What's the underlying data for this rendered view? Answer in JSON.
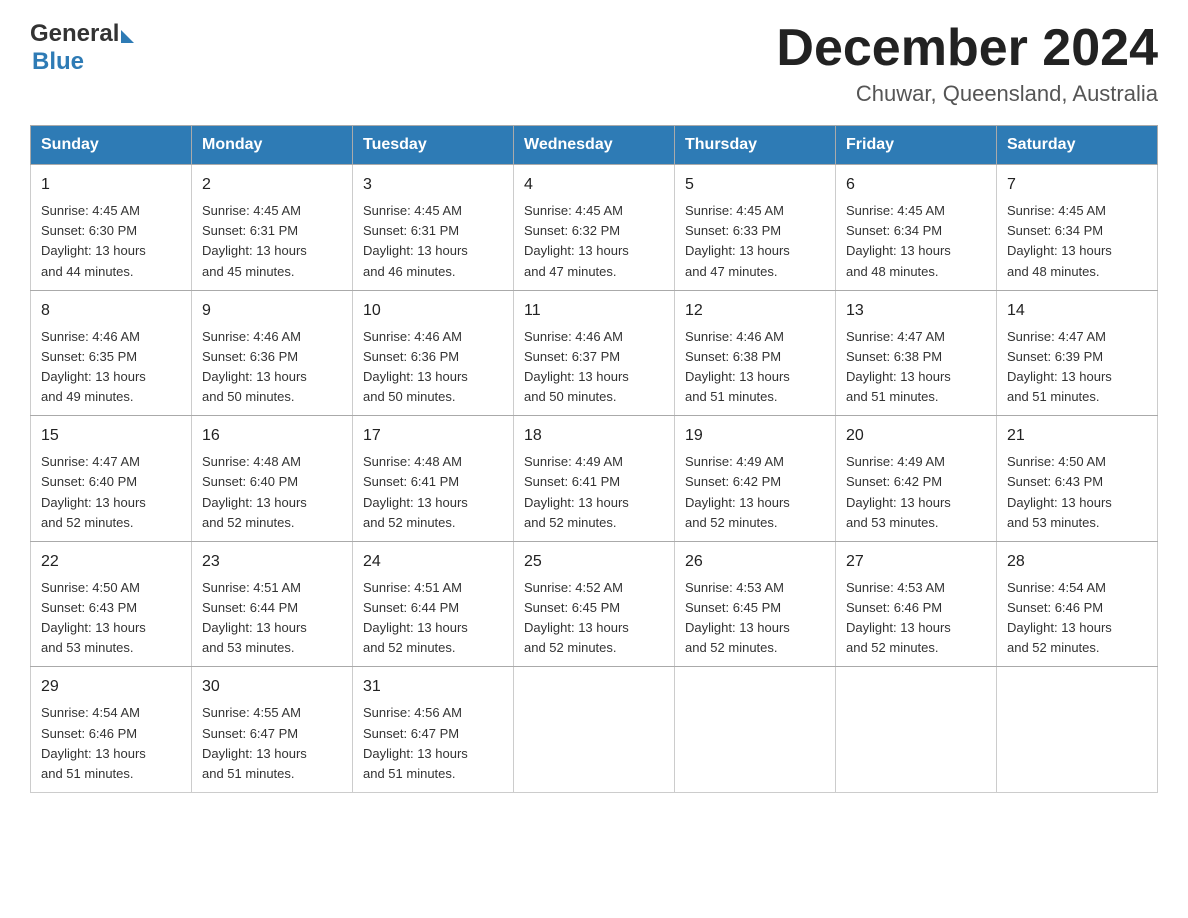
{
  "header": {
    "logo_general": "General",
    "logo_blue": "Blue",
    "title": "December 2024",
    "subtitle": "Chuwar, Queensland, Australia"
  },
  "days_of_week": [
    "Sunday",
    "Monday",
    "Tuesday",
    "Wednesday",
    "Thursday",
    "Friday",
    "Saturday"
  ],
  "weeks": [
    [
      {
        "day": "1",
        "sunrise": "4:45 AM",
        "sunset": "6:30 PM",
        "daylight": "13 hours and 44 minutes."
      },
      {
        "day": "2",
        "sunrise": "4:45 AM",
        "sunset": "6:31 PM",
        "daylight": "13 hours and 45 minutes."
      },
      {
        "day": "3",
        "sunrise": "4:45 AM",
        "sunset": "6:31 PM",
        "daylight": "13 hours and 46 minutes."
      },
      {
        "day": "4",
        "sunrise": "4:45 AM",
        "sunset": "6:32 PM",
        "daylight": "13 hours and 47 minutes."
      },
      {
        "day": "5",
        "sunrise": "4:45 AM",
        "sunset": "6:33 PM",
        "daylight": "13 hours and 47 minutes."
      },
      {
        "day": "6",
        "sunrise": "4:45 AM",
        "sunset": "6:34 PM",
        "daylight": "13 hours and 48 minutes."
      },
      {
        "day": "7",
        "sunrise": "4:45 AM",
        "sunset": "6:34 PM",
        "daylight": "13 hours and 48 minutes."
      }
    ],
    [
      {
        "day": "8",
        "sunrise": "4:46 AM",
        "sunset": "6:35 PM",
        "daylight": "13 hours and 49 minutes."
      },
      {
        "day": "9",
        "sunrise": "4:46 AM",
        "sunset": "6:36 PM",
        "daylight": "13 hours and 50 minutes."
      },
      {
        "day": "10",
        "sunrise": "4:46 AM",
        "sunset": "6:36 PM",
        "daylight": "13 hours and 50 minutes."
      },
      {
        "day": "11",
        "sunrise": "4:46 AM",
        "sunset": "6:37 PM",
        "daylight": "13 hours and 50 minutes."
      },
      {
        "day": "12",
        "sunrise": "4:46 AM",
        "sunset": "6:38 PM",
        "daylight": "13 hours and 51 minutes."
      },
      {
        "day": "13",
        "sunrise": "4:47 AM",
        "sunset": "6:38 PM",
        "daylight": "13 hours and 51 minutes."
      },
      {
        "day": "14",
        "sunrise": "4:47 AM",
        "sunset": "6:39 PM",
        "daylight": "13 hours and 51 minutes."
      }
    ],
    [
      {
        "day": "15",
        "sunrise": "4:47 AM",
        "sunset": "6:40 PM",
        "daylight": "13 hours and 52 minutes."
      },
      {
        "day": "16",
        "sunrise": "4:48 AM",
        "sunset": "6:40 PM",
        "daylight": "13 hours and 52 minutes."
      },
      {
        "day": "17",
        "sunrise": "4:48 AM",
        "sunset": "6:41 PM",
        "daylight": "13 hours and 52 minutes."
      },
      {
        "day": "18",
        "sunrise": "4:49 AM",
        "sunset": "6:41 PM",
        "daylight": "13 hours and 52 minutes."
      },
      {
        "day": "19",
        "sunrise": "4:49 AM",
        "sunset": "6:42 PM",
        "daylight": "13 hours and 52 minutes."
      },
      {
        "day": "20",
        "sunrise": "4:49 AM",
        "sunset": "6:42 PM",
        "daylight": "13 hours and 53 minutes."
      },
      {
        "day": "21",
        "sunrise": "4:50 AM",
        "sunset": "6:43 PM",
        "daylight": "13 hours and 53 minutes."
      }
    ],
    [
      {
        "day": "22",
        "sunrise": "4:50 AM",
        "sunset": "6:43 PM",
        "daylight": "13 hours and 53 minutes."
      },
      {
        "day": "23",
        "sunrise": "4:51 AM",
        "sunset": "6:44 PM",
        "daylight": "13 hours and 53 minutes."
      },
      {
        "day": "24",
        "sunrise": "4:51 AM",
        "sunset": "6:44 PM",
        "daylight": "13 hours and 52 minutes."
      },
      {
        "day": "25",
        "sunrise": "4:52 AM",
        "sunset": "6:45 PM",
        "daylight": "13 hours and 52 minutes."
      },
      {
        "day": "26",
        "sunrise": "4:53 AM",
        "sunset": "6:45 PM",
        "daylight": "13 hours and 52 minutes."
      },
      {
        "day": "27",
        "sunrise": "4:53 AM",
        "sunset": "6:46 PM",
        "daylight": "13 hours and 52 minutes."
      },
      {
        "day": "28",
        "sunrise": "4:54 AM",
        "sunset": "6:46 PM",
        "daylight": "13 hours and 52 minutes."
      }
    ],
    [
      {
        "day": "29",
        "sunrise": "4:54 AM",
        "sunset": "6:46 PM",
        "daylight": "13 hours and 51 minutes."
      },
      {
        "day": "30",
        "sunrise": "4:55 AM",
        "sunset": "6:47 PM",
        "daylight": "13 hours and 51 minutes."
      },
      {
        "day": "31",
        "sunrise": "4:56 AM",
        "sunset": "6:47 PM",
        "daylight": "13 hours and 51 minutes."
      },
      null,
      null,
      null,
      null
    ]
  ]
}
